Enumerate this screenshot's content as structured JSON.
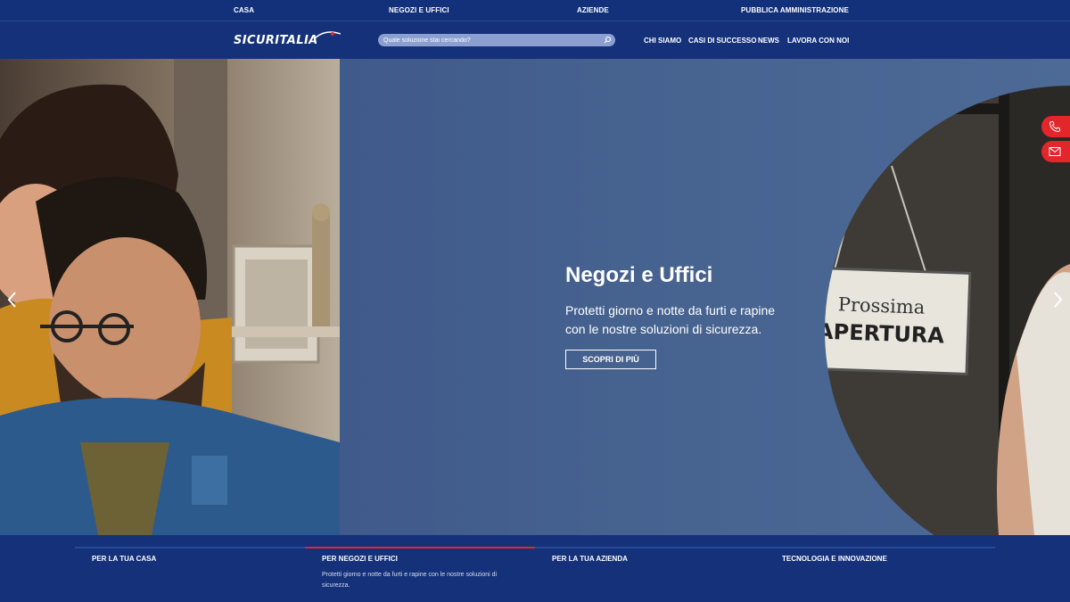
{
  "topbar": {
    "categories": [
      "CASA",
      "NEGOZI E UFFICI",
      "AZIENDE",
      "PUBBLICA AMMINISTRAZIONE"
    ]
  },
  "header": {
    "logo_text": "SICURITALIA",
    "search_placeholder": "Quale soluzione stai cercando?",
    "nav": [
      "CHI SIAMO",
      "CASI DI SUCCESSO",
      "NEWS",
      "LAVORA CON NOI"
    ]
  },
  "hero": {
    "title": "Negozi e Uffici",
    "description": "Protetti giorno e notte da furti e rapine con le nostre soluzioni di sicurezza.",
    "button_label": "SCOPRI DI PIÙ",
    "sign_line1": "Prossima",
    "sign_line2": "APERTURA"
  },
  "tabs": [
    {
      "label": "PER LA TUA CASA",
      "description": "",
      "active": false
    },
    {
      "label": "PER NEGOZI E UFFICI",
      "description": "Protetti giorno e notte da furti e rapine con le nostre soluzioni di sicurezza.",
      "active": true
    },
    {
      "label": "PER LA TUA AZIENDA",
      "description": "",
      "active": false
    },
    {
      "label": "TECNOLOGIA E INNOVAZIONE",
      "description": "",
      "active": false
    }
  ],
  "icons": {
    "search": "search-icon",
    "phone": "phone-icon",
    "mail": "mail-icon",
    "prev": "chevron-left-icon",
    "next": "chevron-right-icon"
  },
  "colors": {
    "brand_blue": "#15317a",
    "accent_red": "#e3262a",
    "hero_blue": "#46628f"
  }
}
